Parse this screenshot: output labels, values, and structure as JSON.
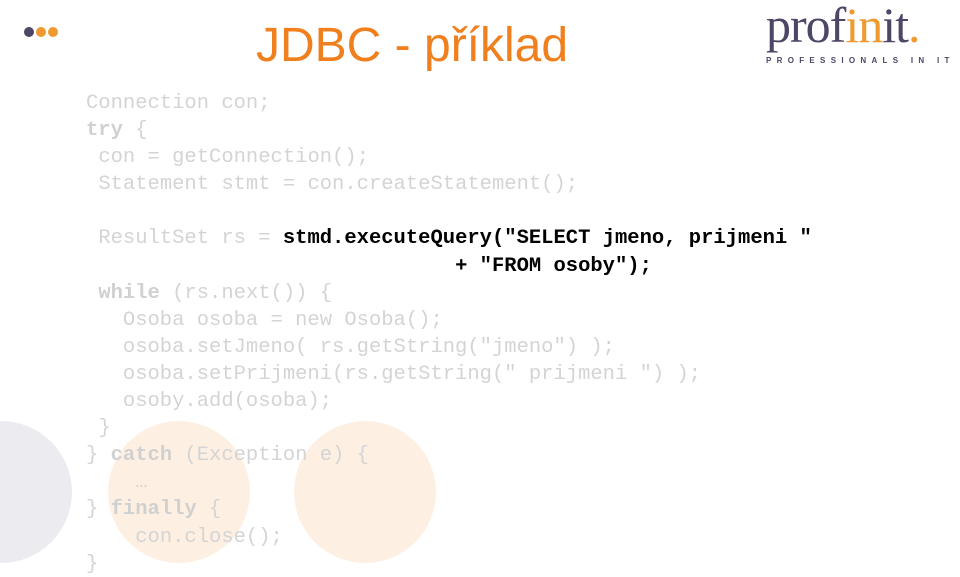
{
  "slide": {
    "title": "JDBC - příklad",
    "colors": {
      "title": "#f07f1e",
      "brand_purple": "#4f4566",
      "brand_orange": "#ef9a2e",
      "code_faded": "#d4d4d4",
      "code_highlight": "#000000"
    },
    "logo": {
      "word_part1": "prof",
      "word_accent": "in",
      "word_part2": "it",
      "word_dot": ".",
      "tagline": "PROFESSIONALS IN IT"
    },
    "decor": {
      "dots_icon": "three-dots-icon"
    }
  },
  "code": {
    "lines": [
      {
        "indent": "",
        "parts": [
          {
            "t": "Connection con;"
          }
        ]
      },
      {
        "indent": "",
        "parts": [
          {
            "t": "try",
            "kw": true
          },
          {
            "t": " {"
          }
        ]
      },
      {
        "indent": " ",
        "parts": [
          {
            "t": "con = getConnection();"
          }
        ]
      },
      {
        "indent": " ",
        "parts": [
          {
            "t": "Statement stmt = con.createStatement();"
          }
        ]
      },
      {
        "indent": "",
        "parts": [
          {
            "t": ""
          }
        ]
      },
      {
        "indent": " ",
        "parts": [
          {
            "t": "ResultSet rs = "
          },
          {
            "t": "stmd.executeQuery(\"SELECT jmeno, prijmeni \"",
            "hl": true
          }
        ]
      },
      {
        "indent": "                              ",
        "parts": [
          {
            "t": "+ \"FROM osoby\");",
            "hl": true
          }
        ]
      },
      {
        "indent": " ",
        "parts": [
          {
            "t": "while",
            "kw": true
          },
          {
            "t": " (rs.next()) {"
          }
        ]
      },
      {
        "indent": "   ",
        "parts": [
          {
            "t": "Osoba osoba = new Osoba();"
          }
        ]
      },
      {
        "indent": "   ",
        "parts": [
          {
            "t": "osoba.setJmeno( rs.getString(\"jmeno\") );"
          }
        ]
      },
      {
        "indent": "   ",
        "parts": [
          {
            "t": "osoba.setPrijmeni(rs.getString(\" prijmeni \") );"
          }
        ]
      },
      {
        "indent": "   ",
        "parts": [
          {
            "t": "osoby.add(osoba);"
          }
        ]
      },
      {
        "indent": " ",
        "parts": [
          {
            "t": "}"
          }
        ]
      },
      {
        "indent": "",
        "parts": [
          {
            "t": "} "
          },
          {
            "t": "catch",
            "kw": true
          },
          {
            "t": " (Exception e) {"
          }
        ]
      },
      {
        "indent": "    ",
        "parts": [
          {
            "t": "…"
          }
        ]
      },
      {
        "indent": "",
        "parts": [
          {
            "t": "} "
          },
          {
            "t": "finally",
            "kw": true
          },
          {
            "t": " {"
          }
        ]
      },
      {
        "indent": "    ",
        "parts": [
          {
            "t": "con.close();"
          }
        ]
      },
      {
        "indent": "",
        "parts": [
          {
            "t": "}"
          }
        ]
      }
    ]
  }
}
